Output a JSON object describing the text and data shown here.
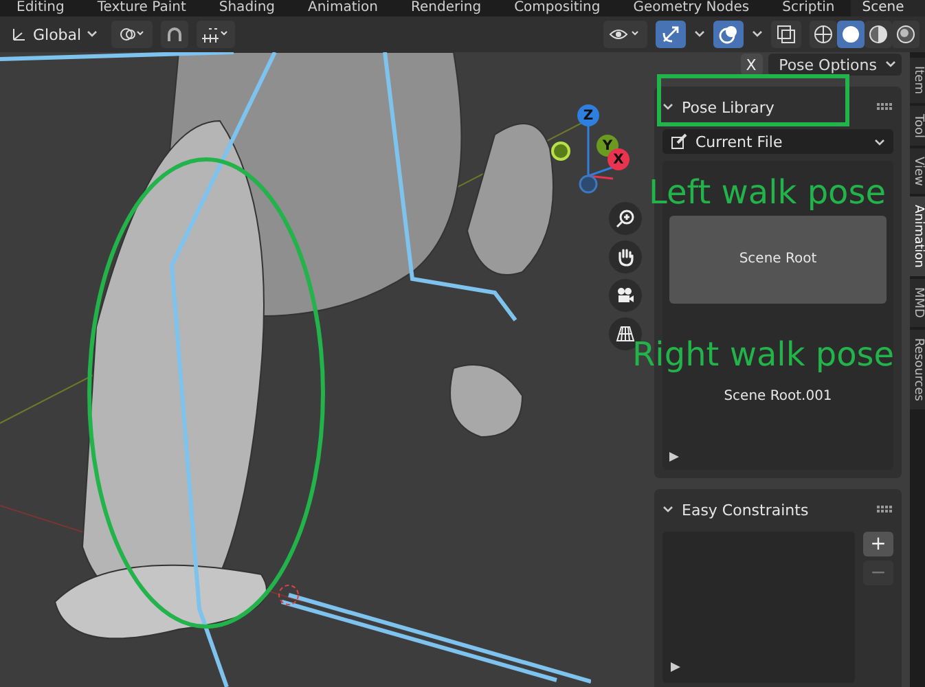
{
  "workspace_tabs": [
    {
      "label": "Editing",
      "selected": false
    },
    {
      "label": "Texture Paint",
      "selected": false
    },
    {
      "label": "Shading",
      "selected": false
    },
    {
      "label": "Animation",
      "selected": false
    },
    {
      "label": "Rendering",
      "selected": false
    },
    {
      "label": "Compositing",
      "selected": false
    },
    {
      "label": "Geometry Nodes",
      "selected": false
    },
    {
      "label": "Scriptin",
      "selected": false
    }
  ],
  "scene_field": {
    "value": "Scene"
  },
  "header": {
    "orientation": "Global",
    "snap_on": false,
    "overlays_on": true,
    "gizmos_on": true,
    "xray_on": false,
    "shading_modes": [
      {
        "kind": "wireframe",
        "selected": false
      },
      {
        "kind": "solid",
        "selected": true
      },
      {
        "kind": "material",
        "selected": false
      },
      {
        "kind": "rendered",
        "selected": false
      }
    ]
  },
  "gizmo": {
    "axes": [
      {
        "label": "Z",
        "color": "#2f7fe0"
      },
      {
        "label": "Y",
        "color": "#6a9a1f"
      },
      {
        "label": "X",
        "color": "#e8344e"
      }
    ]
  },
  "sidebar": {
    "close": "X",
    "pose_options": "Pose Options",
    "pose_library": {
      "title": "Pose Library",
      "expanded": true,
      "library": "Current File",
      "poses": [
        {
          "name": "Scene Root",
          "selected": true
        },
        {
          "name": "Scene Root.001",
          "selected": false
        }
      ]
    },
    "easy_constraints": {
      "title": "Easy Constraints",
      "expanded": true,
      "add": "+",
      "remove": "−"
    }
  },
  "sidebar_tabs": [
    {
      "label": "Item",
      "selected": false
    },
    {
      "label": "Tool",
      "selected": false
    },
    {
      "label": "View",
      "selected": false
    },
    {
      "label": "Animation",
      "selected": true
    },
    {
      "label": "MMD",
      "selected": false
    },
    {
      "label": "Resources",
      "selected": false
    }
  ],
  "annotations": [
    {
      "text": "Left walk pose"
    },
    {
      "text": "Right walk pose"
    }
  ]
}
